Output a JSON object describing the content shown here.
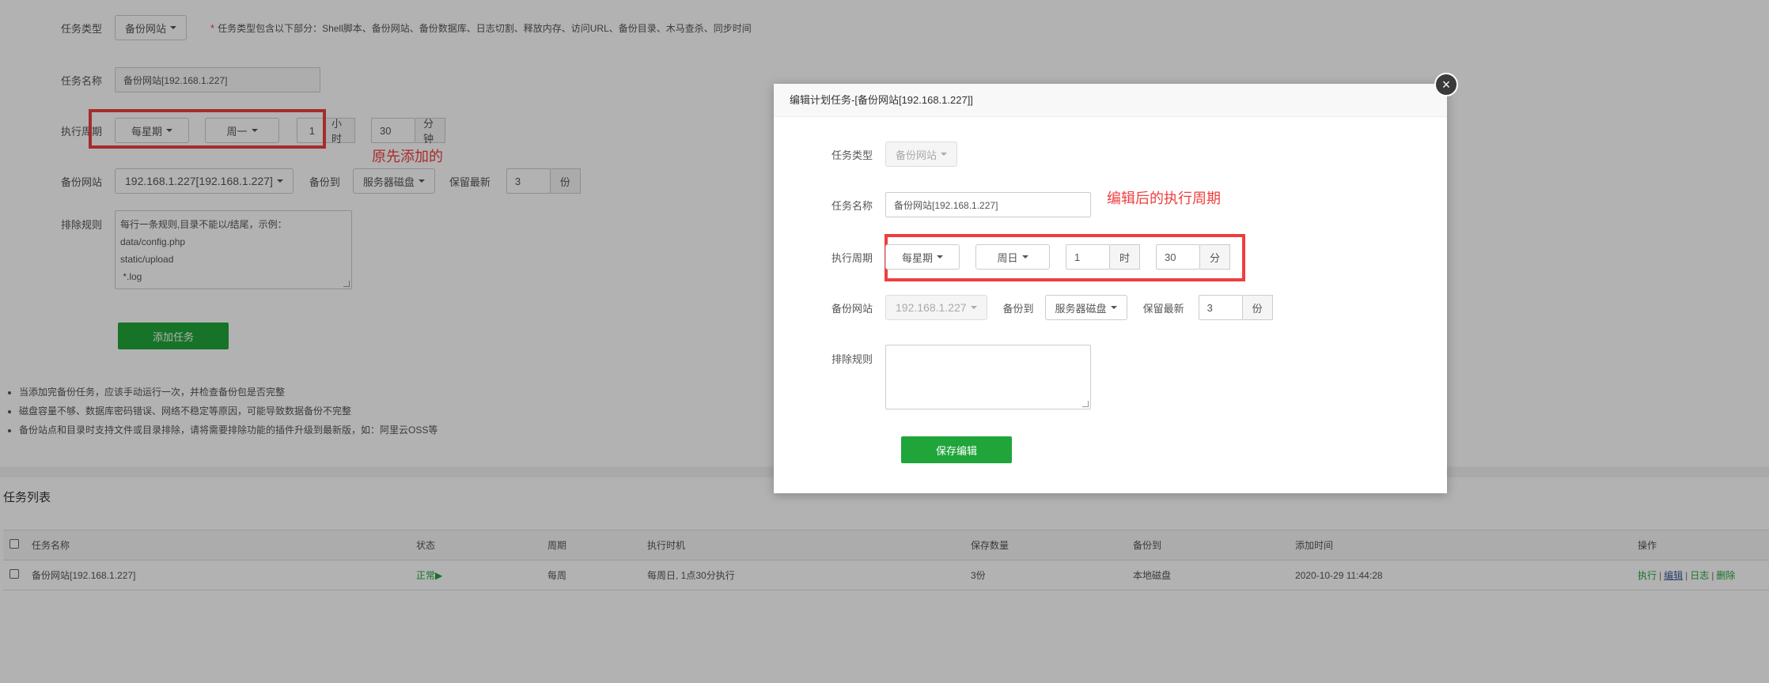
{
  "form": {
    "task_type_label": "任务类型",
    "task_type_value": "备份网站",
    "task_type_note": "任务类型包含以下部分：Shell脚本、备份网站、备份数据库、日志切割、释放内存、访问URL、备份目录、木马查杀、同步时间",
    "task_name_label": "任务名称",
    "task_name_value": "备份网站[192.168.1.227]",
    "cycle_label": "执行周期",
    "cycle_type": "每星期",
    "cycle_day": "周一",
    "cycle_hour": "1",
    "hour_unit": "小时",
    "cycle_minute": "30",
    "minute_unit": "分钟",
    "site_label": "备份网站",
    "site_value": "192.168.1.227[192.168.1.227]",
    "backup_to_label": "备份到",
    "backup_to_value": "服务器磁盘",
    "keep_label": "保留最新",
    "keep_value": "3",
    "keep_unit": "份",
    "exclude_label": "排除规则",
    "exclude_placeholder_lines": [
      "每行一条规则,目录不能以/结尾，示例：",
      "data/config.php",
      "static/upload",
      " *.log"
    ],
    "add_button": "添加任务"
  },
  "tips": [
    "当添加完备份任务，应该手动运行一次，并检查备份包是否完整",
    "磁盘容量不够、数据库密码错误、网络不稳定等原因，可能导致数据备份不完整",
    "备份站点和目录时支持文件或目录排除，请将需要排除功能的插件升级到最新版，如：阿里云OSS等"
  ],
  "task_list": {
    "title": "任务列表",
    "headers": [
      "任务名称",
      "状态",
      "周期",
      "执行时机",
      "保存数量",
      "备份到",
      "添加时间",
      "操作"
    ],
    "rows": [
      {
        "name": "备份网站[192.168.1.227]",
        "status": "正常",
        "status_icon": "▶",
        "cycle": "每周",
        "timing": "每周日, 1点30分执行",
        "count": "3份",
        "backup_to": "本地磁盘",
        "added": "2020-10-29 11:44:28",
        "ops": [
          "执行",
          "编辑",
          "日志",
          "删除"
        ]
      }
    ]
  },
  "annotations": {
    "original": "原先添加的",
    "edited": "编辑后的执行周期"
  },
  "dialog": {
    "title": "编辑计划任务-[备份网站[192.168.1.227]]",
    "close": "×",
    "task_type_label": "任务类型",
    "task_type_value": "备份网站",
    "task_name_label": "任务名称",
    "task_name_value": "备份网站[192.168.1.227]",
    "cycle_label": "执行周期",
    "cycle_type": "每星期",
    "cycle_day": "周日",
    "cycle_hour": "1",
    "hour_unit": "时",
    "cycle_minute": "30",
    "minute_unit": "分",
    "site_label": "备份网站",
    "site_value": "192.168.1.227",
    "backup_to_label": "备份到",
    "backup_to_value": "服务器磁盘",
    "keep_label": "保留最新",
    "keep_value": "3",
    "keep_unit": "份",
    "exclude_label": "排除规则",
    "save_button": "保存编辑"
  },
  "colors": {
    "accent": "#20a53a",
    "annotation": "#ef3e3e",
    "overlay": "rgba(0,0,0,0.3)"
  }
}
